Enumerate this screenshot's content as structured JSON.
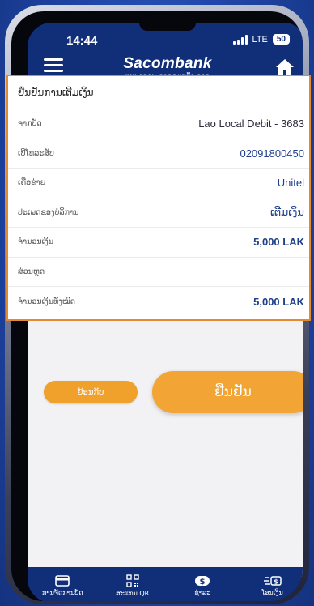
{
  "status_bar": {
    "time": "14:44",
    "network": "LTE",
    "battery": "50"
  },
  "header": {
    "brand": "Sacombank",
    "brand_subtitle": "ທະນາຄານ ຊາຄອມແບັງ ລາວ"
  },
  "confirm_panel": {
    "title": "ຢືນຢັນການເຕີມເງິນ",
    "rows": [
      {
        "label": "ຈາກບັດ",
        "value": "Lao Local Debit - 3683"
      },
      {
        "label": "ເບີໂທລະສັບ",
        "value": "02091800450"
      },
      {
        "label": "ເຄືອຂ່າຍ",
        "value": "Unitel"
      },
      {
        "label": "ປະເພດຂອງບໍລິການ",
        "value": "ເຕີມເງິນ"
      },
      {
        "label": "ຈໍານວນເງິນ",
        "value": "5,000 LAK"
      },
      {
        "label": "ສ່ວນຫຼຸດ",
        "value": ""
      },
      {
        "label": "ຈໍານວນເງິນທັງໝົດ",
        "value": "5,000 LAK"
      }
    ]
  },
  "actions": {
    "back_label": "ຍ້ອນກັບ",
    "confirm_label": "ຢືນຢັນ"
  },
  "bottom_nav": [
    {
      "label": "ການຈັດການບັດ",
      "icon": "card-icon"
    },
    {
      "label": "ສະແກນ QR",
      "icon": "qr-icon"
    },
    {
      "label": "ຊໍາລະ",
      "icon": "payment-icon"
    },
    {
      "label": "ໂອນເງິນ",
      "icon": "transfer-icon"
    }
  ],
  "colors": {
    "primary": "#112f79",
    "accent": "#f2a534",
    "highlight_border": "#e58a2e",
    "value_text": "#1f3f8a"
  }
}
